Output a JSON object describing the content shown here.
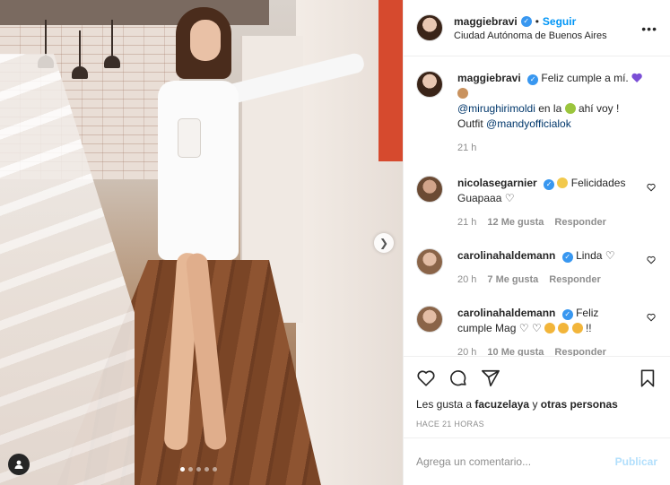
{
  "post": {
    "username": "maggiebravi",
    "follow_label": "Seguir",
    "location": "Ciudad Autónoma de Buenos Aires",
    "more_icon": "more-options-icon",
    "image": {
      "carousel_dots": 5,
      "active_dot": 0
    }
  },
  "caption": {
    "username": "maggiebravi",
    "text_1": "Feliz cumple a mí.",
    "mention_1": "@mirughirimoldi",
    "text_2": "en la",
    "text_3": "ahí voy !",
    "text_4": "Outfit",
    "mention_2": "@mandyofficialok",
    "time": "21 h"
  },
  "comments": [
    {
      "username": "nicolasegarnier",
      "text_1": "Felicidades",
      "text_2": "Guapaaa",
      "time": "21 h",
      "likes": "12 Me gusta",
      "reply": "Responder"
    },
    {
      "username": "carolinahaldemann",
      "text_1": "Linda",
      "time": "20 h",
      "likes": "7 Me gusta",
      "reply": "Responder"
    },
    {
      "username": "carolinahaldemann",
      "text_1": "Feliz",
      "text_2": "cumple Mag",
      "text_3": "!!",
      "time": "20 h",
      "likes": "10 Me gusta",
      "reply": "Responder"
    }
  ],
  "likes": {
    "prefix": "Les gusta a",
    "user": "facuzelaya",
    "middle": "y",
    "others": "otras personas"
  },
  "timestamp": "HACE 21 HORAS",
  "add_comment": {
    "placeholder": "Agrega un comentario...",
    "publish_label": "Publicar"
  },
  "colors": {
    "link": "#0095f6",
    "mention": "#00376b",
    "muted": "#8e8e8e",
    "publish_disabled": "#b2dffc",
    "verified": "#3897f0"
  }
}
